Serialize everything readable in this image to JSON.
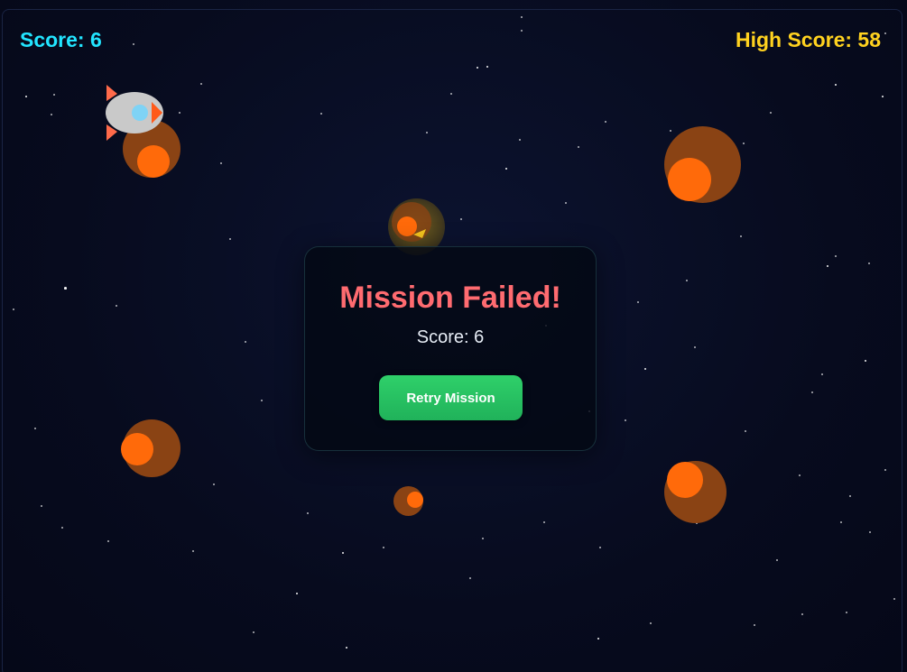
{
  "hud": {
    "score_label": "Score: 6",
    "high_score_label": "High Score: 58"
  },
  "modal": {
    "title": "Mission Failed!",
    "score_text": "Score: 6",
    "retry_label": "Retry Mission"
  },
  "colors": {
    "score": "#22e5ff",
    "high_score": "#ffd21f",
    "title": "#ff6b70",
    "button_start": "#2fd06a",
    "button_end": "#20b25a",
    "asteroid": "#8a4314",
    "asteroid_core": "#ff6a0a"
  },
  "entities": {
    "ship": "rocket-ship",
    "asteroids": "asteroid",
    "powerup": "shield-powerup"
  }
}
